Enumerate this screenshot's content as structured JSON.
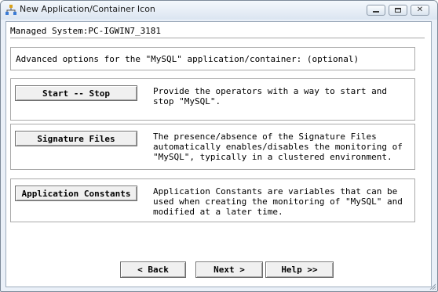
{
  "window": {
    "title": "New Application/Container Icon",
    "icon": "app-tree-icon",
    "controls": {
      "minimize": "minimize-icon",
      "maximize": "maximize-icon",
      "close": "close-icon"
    }
  },
  "managed_system": "Managed System:PC-IGWIN7_3181",
  "advanced_text": "Advanced options for the \"MySQL\" application/container: (optional)",
  "options": [
    {
      "button": "Start -- Stop",
      "description": "Provide the operators with a way to start and\nstop \"MySQL\"."
    },
    {
      "button": "Signature Files",
      "description": "The presence/absence of the Signature Files\nautomatically enables/disables the monitoring of\n\"MySQL\", typically in a clustered environment."
    },
    {
      "button": "Application Constants",
      "description": "Application Constants are variables that can be\nused when creating the monitoring of \"MySQL\" and\nmodified at a later time."
    }
  ],
  "nav": {
    "back": "< Back",
    "next": "Next >",
    "help": "Help >>"
  },
  "colors": {
    "title_bar": "#dbe5f1",
    "frame": "#eaf0f8",
    "content": "#ffffff"
  }
}
